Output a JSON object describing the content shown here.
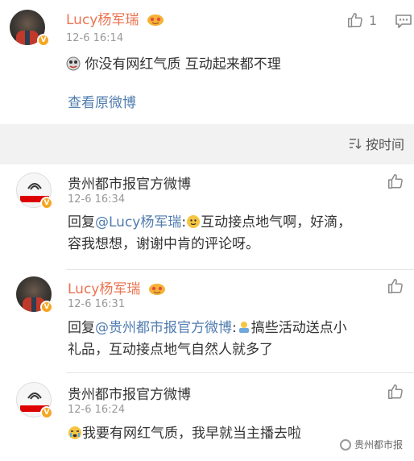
{
  "main_comment": {
    "user": "Lucy杨军瑞",
    "time": "12-6 16:14",
    "text": "你没有网红气质 互动起来都不理",
    "view_original": "查看原微博",
    "like_count": "1"
  },
  "sort": {
    "label": "按时间"
  },
  "replies": [
    {
      "user": "贵州都市报官方微博",
      "time": "12-6 16:34",
      "prefix": "回复",
      "mention": "@Lucy杨军瑞",
      "text_line1": "互动接点地气啊，好滴，",
      "text_line2": "容我想想，谢谢中肯的评论呀。"
    },
    {
      "user": "Lucy杨军瑞",
      "time": "12-6 16:31",
      "prefix": "回复",
      "mention": "@贵州都市报官方微博",
      "text_line1": "搞些活动送点小",
      "text_line2": "礼品，互动接点地气自然人就多了"
    },
    {
      "user": "贵州都市报官方微博",
      "time": "12-6 16:24",
      "text_line1": "我要有网红气质，我早就当主播去啦"
    }
  ],
  "watermark": "贵州都市报",
  "colors": {
    "name_orange": "#eb7350",
    "link_blue": "#507daf",
    "verified": "#f5a623"
  }
}
